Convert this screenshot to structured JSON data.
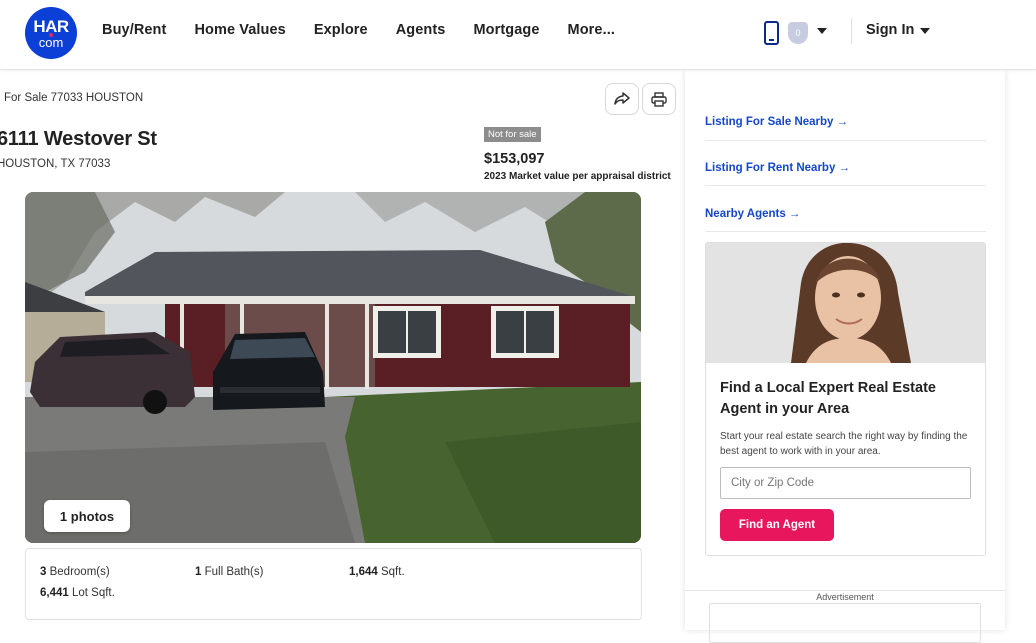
{
  "header": {
    "logo_top": "HAR",
    "logo_bottom": "com",
    "nav": [
      "Buy/Rent",
      "Home Values",
      "Explore",
      "Agents",
      "Mortgage",
      "More..."
    ],
    "notification_count": "0",
    "sign_in": "Sign In"
  },
  "listing": {
    "breadcrumb": "For Sale 77033 HOUSTON",
    "address": "6111 Westover St",
    "city_line": "HOUSTON, TX 77033",
    "status_badge": "Not for sale",
    "price": "$153,097",
    "price_note": "2023 Market value per appraisal district",
    "photos_label": "1 photos",
    "facts": {
      "bedrooms_value": "3",
      "bedrooms_label": "Bedroom(s)",
      "baths_value": "1",
      "baths_label": "Full Bath(s)",
      "sqft_value": "1,644",
      "sqft_label": "Sqft.",
      "lot_value": "6,441",
      "lot_label": "Lot Sqft."
    }
  },
  "sidebar": {
    "links": [
      "Listing For Sale Nearby →",
      "Listing For Rent Nearby →",
      "Nearby Agents →"
    ],
    "card_title": "Find a Local Expert Real Estate Agent in your Area",
    "card_text": "Start your real estate search the right way by finding the best agent to work with in your area.",
    "zip_placeholder": "City or Zip Code",
    "find_button": "Find an Agent",
    "ad_label": "Advertisement"
  },
  "colors": {
    "brand_blue": "#0b3fd6",
    "link_blue": "#1447c8",
    "accent_pink": "#e8175d"
  }
}
